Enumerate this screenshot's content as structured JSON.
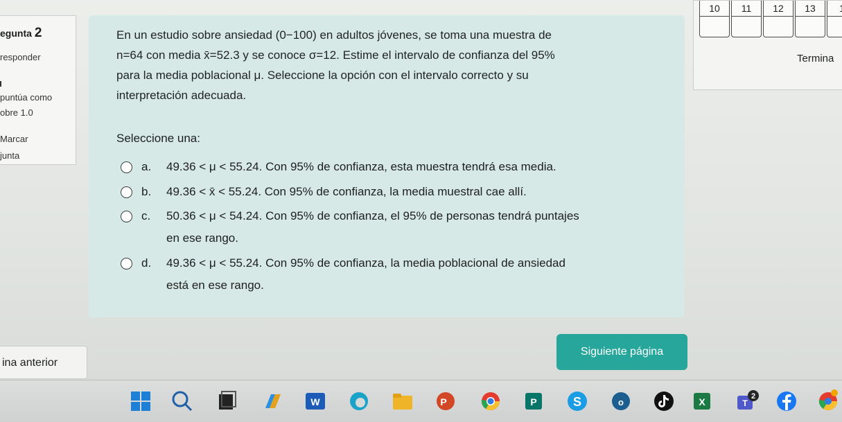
{
  "sidebar_info": {
    "question_label": "egunta",
    "question_number": "2",
    "status": "responder",
    "score_line1": "puntúa como",
    "score_line2": "obre 1.0",
    "flag_line1": "Marcar",
    "flag_line2": "junta"
  },
  "question": {
    "lines": [
      "En un estudio sobre ansiedad (0−100) en adultos jóvenes, se toma una muestra de",
      "n=64 con media x̄=52.3 y se conoce σ=12. Estime el intervalo de confianza del 95%",
      "para la media poblacional μ. Seleccione la opción con el intervalo correcto y su",
      "interpretación adecuada."
    ],
    "select_label": "Seleccione una:",
    "options": [
      {
        "letter": "a.",
        "line1": "49.36 < μ < 55.24. Con 95% de confianza, esta muestra tendrá esa media.",
        "line2": ""
      },
      {
        "letter": "b.",
        "line1": "49.36 < x̄ < 55.24. Con 95% de confianza, la media muestral cae allí.",
        "line2": ""
      },
      {
        "letter": "c.",
        "line1": "50.36 < μ < 54.24. Con 95% de confianza, el 95% de personas tendrá puntajes",
        "line2": "en ese rango."
      },
      {
        "letter": "d.",
        "line1": "49.36 < μ < 55.24. Con 95% de confianza, la media poblacional de ansiedad",
        "line2": "está en ese rango."
      }
    ]
  },
  "nav": {
    "cells": [
      "10",
      "11",
      "12",
      "13",
      "1"
    ],
    "finish_label": "Termina"
  },
  "buttons": {
    "prev": "ina anterior",
    "next": "Siguiente página"
  },
  "taskbar": {
    "icons": [
      "windows-start-icon",
      "search-icon",
      "task-view-icon",
      "copilot-icon",
      "word-icon",
      "edge-icon",
      "file-explorer-icon",
      "powerpoint-icon",
      "chrome-icon",
      "publisher-icon",
      "skype-icon",
      "office-icon",
      "tiktok-icon",
      "excel-icon",
      "teams-icon",
      "facebook-icon",
      "chrome-profile-icon"
    ],
    "teams_badge": "2"
  }
}
